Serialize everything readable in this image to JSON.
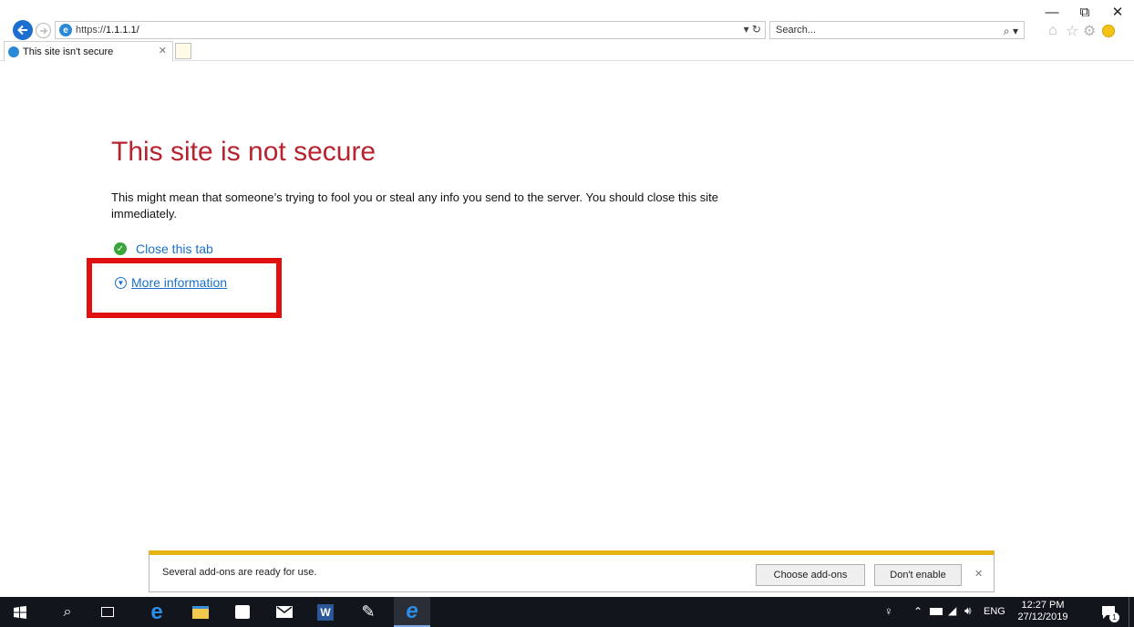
{
  "browser": {
    "url_prefix": "https://",
    "url_host": "1.1.1.1/",
    "search_placeholder": "Search...",
    "tab_title": "This site isn't secure"
  },
  "page": {
    "heading": "This site is not secure",
    "paragraph": "This might mean that someone’s trying to fool you or steal any info you send to the server. You should close this site immediately.",
    "close_tab_label": "Close this tab",
    "more_info_label": "More information"
  },
  "notification": {
    "message": "Several add-ons are ready for use.",
    "choose_label": "Choose add-ons",
    "dont_enable_label": "Don't enable"
  },
  "taskbar": {
    "language": "ENG",
    "time": "12:27 PM",
    "date": "27/12/2019",
    "notification_count": "1"
  },
  "colors": {
    "heading": "#b8232f",
    "link": "#1a70c8",
    "highlight_box": "#e01010",
    "notification_accent": "#e7b416",
    "taskbar": "#12161c"
  },
  "icons": [
    "back-icon",
    "forward-icon",
    "ie-favicon",
    "refresh-icon",
    "search-icon",
    "home-icon",
    "favorites-star-icon",
    "settings-gear-icon",
    "smiley-feedback-icon",
    "minimize-icon",
    "restore-icon",
    "close-icon",
    "shield-check-icon",
    "expand-circle-icon",
    "windows-start-icon",
    "cortana-search-icon",
    "task-view-icon",
    "edge-icon",
    "file-explorer-icon",
    "store-icon",
    "mail-icon",
    "word-icon",
    "paint-icon",
    "ie-icon",
    "people-icon",
    "chevron-up-icon",
    "battery-icon",
    "wifi-icon",
    "volume-icon",
    "action-center-icon"
  ]
}
